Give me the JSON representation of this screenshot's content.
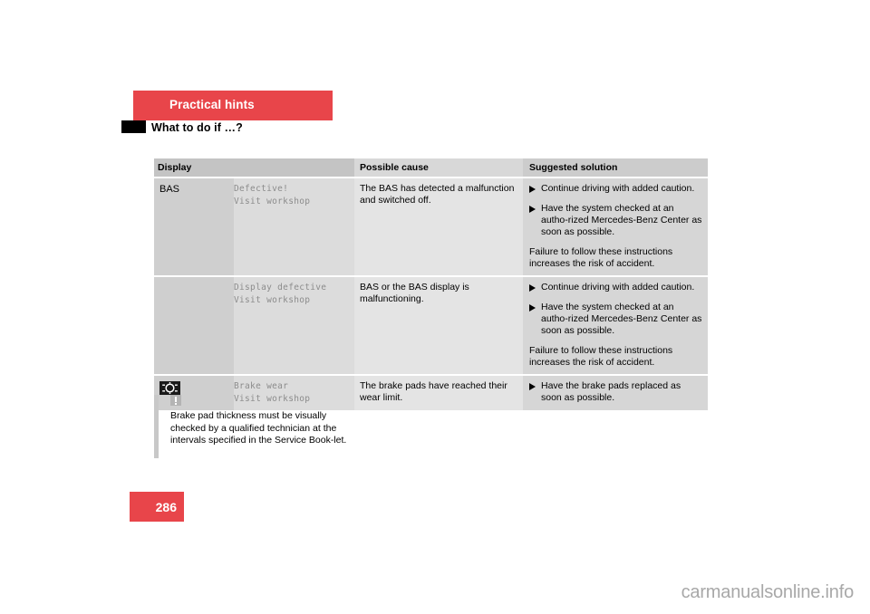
{
  "header": {
    "chapter_title": "Practical hints",
    "section_title": "What to do if …?",
    "band_color": "#e8454a"
  },
  "table": {
    "columns": [
      "Display",
      "Possible cause",
      "Suggested solution"
    ],
    "rows": [
      {
        "symbol_text": "BAS",
        "symbol_icon": "",
        "display_message": "Defective!\nVisit workshop",
        "possible_cause": "The BAS has detected a malfunction and switched off.",
        "solutions": [
          "Continue driving with added caution.",
          "Have the system checked at an autho-rized Mercedes-Benz Center as soon as possible."
        ],
        "footer_note": "Failure to follow these instructions increases the risk of accident."
      },
      {
        "symbol_text": "",
        "symbol_icon": "",
        "display_message": "Display defective\nVisit workshop",
        "possible_cause": "BAS or the BAS display is malfunctioning.",
        "solutions": [
          "Continue driving with added caution.",
          "Have the system checked at an autho-rized Mercedes-Benz Center as soon as possible."
        ],
        "footer_note": "Failure to follow these instructions increases the risk of accident."
      },
      {
        "symbol_text": "",
        "symbol_icon": "brake-wear-telltale-icon",
        "display_message": "Brake wear\nVisit workshop",
        "possible_cause": "The brake pads have reached their wear limit.",
        "solutions": [
          "Have the brake pads replaced as soon as possible."
        ],
        "footer_note": ""
      }
    ]
  },
  "note": {
    "icon": "exclamation-icon",
    "text": "Brake pad thickness must be visually checked by a qualified technician at the intervals specified in the Service Book-let."
  },
  "page_number": "286",
  "watermark": "carmanualsonline.info"
}
